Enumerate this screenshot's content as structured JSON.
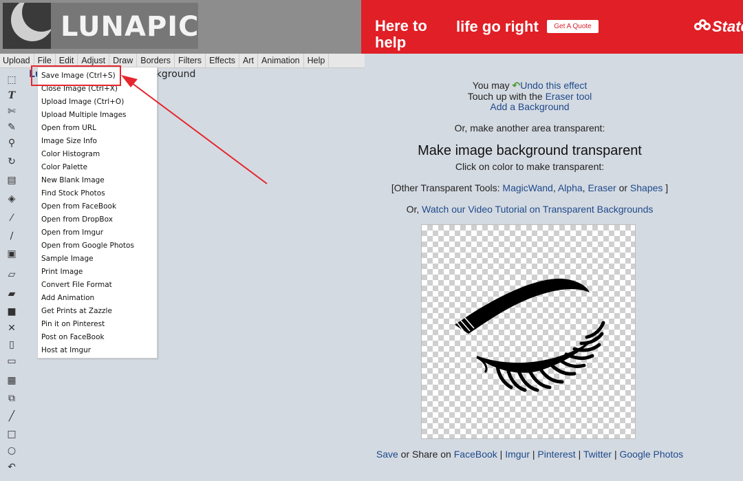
{
  "header": {
    "logo_text": "LUNAPIC"
  },
  "ad": {
    "line1": "Here to help",
    "line2": "life go right",
    "button": "Get A Quote",
    "brand": "State",
    "brand_color": "#e01f26"
  },
  "menubar": {
    "items": [
      "Upload",
      "File",
      "Edit",
      "Adjust",
      "Draw",
      "Borders",
      "Filters",
      "Effects",
      "Art",
      "Animation",
      "Help"
    ]
  },
  "toolbar": {
    "tools": [
      "select-icon",
      "text-icon",
      "scissors-icon",
      "pencil-icon",
      "zoom-icon",
      "rotate-icon",
      "crop-icon",
      "paint-bucket-icon",
      "eyedropper-icon",
      "brush-icon",
      "image-stack-icon",
      "eraser-icon",
      "open-folder-icon",
      "save-icon",
      "close-icon",
      "new-page-icon",
      "print-icon",
      "gallery-icon",
      "copy-icon",
      "line-icon",
      "rectangle-icon",
      "circle-icon",
      "undo-icon"
    ]
  },
  "behind_text": {
    "title_fragment": "Lu",
    "title_rest": "Background"
  },
  "file_menu": {
    "items": [
      "Save Image (Ctrl+S)",
      "Close Image (Ctrl+X)",
      "Upload Image (Ctrl+O)",
      "Upload Multiple Images",
      "Open from URL",
      "Image Size Info",
      "Color Histogram",
      "Color Palette",
      "New Blank Image",
      "Find Stock Photos",
      "Open from FaceBook",
      "Open from DropBox",
      "Open from Imgur",
      "Open from Google Photos",
      "Sample Image",
      "Print Image",
      "Convert File Format",
      "Add Animation",
      "Get Prints at Zazzle",
      "Pin it on Pinterest",
      "Post on FaceBook",
      "Host at Imgur"
    ],
    "highlight_color": "#e5262d"
  },
  "main": {
    "undo_prefix": "You may",
    "undo_link": "Undo this effect",
    "touch_prefix": "Touch up with the",
    "eraser_link": "Eraser tool",
    "background_link": "Add a Background",
    "another_area": "Or, make another area transparent:",
    "heading": "Make image background transparent",
    "instruction": "Click on color to make transparent:",
    "other_tools_prefix": "[Other Transparent Tools:",
    "tool_magicwand": "MagicWand",
    "tool_alpha": "Alpha",
    "tool_eraser": "Eraser",
    "tool_or": "or",
    "tool_shapes": "Shapes",
    "other_tools_suffix": "]",
    "video_prefix": "Or,",
    "video_link": "Watch our Video Tutorial on Transparent Backgrounds"
  },
  "share": {
    "save": "Save",
    "or_share_on": "or Share on",
    "facebook": "FaceBook",
    "imgur": "Imgur",
    "pinterest": "Pinterest",
    "twitter": "Twitter",
    "google_photos": "Google Photos",
    "separator": "|"
  },
  "colors": {
    "link": "#1e4a8a",
    "background": "#d4dae2",
    "annotation": "#e5262d"
  }
}
